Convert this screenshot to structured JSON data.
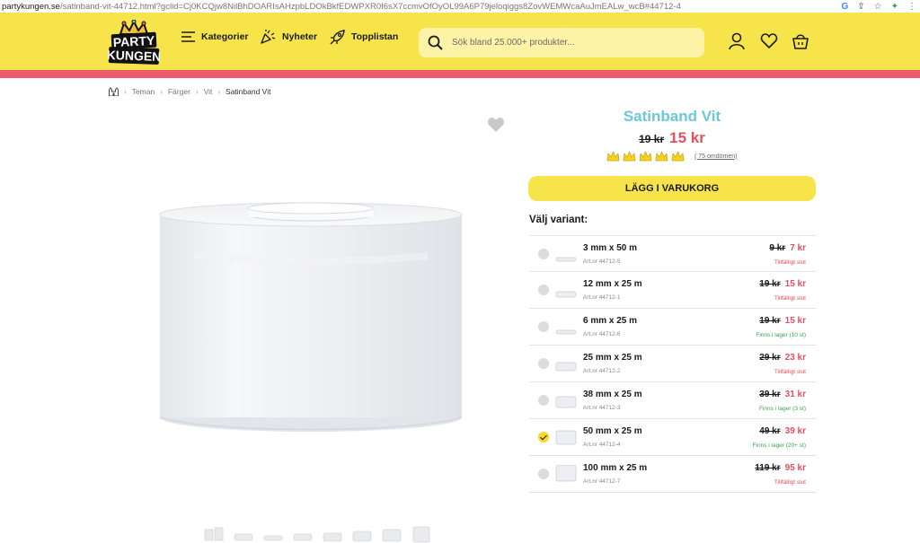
{
  "browser": {
    "url_domain": "partykungen.se",
    "url_rest": "/satinband-vit-44712.html?gclid=Cj0KCQjw8NilBhDOARIsAHzpbLDOkBkfEDWPXR0I6sX7ccmvOfOyOL99A6P79jeloqiggs8ZovWEMWcaAuJmEALw_wcB#44712-4"
  },
  "header": {
    "logo_text": "PARTY KUNGEN",
    "nav": {
      "categories": "Kategorier",
      "news": "Nyheter",
      "toplist": "Topplistan"
    },
    "search_placeholder": "Sök bland 25.000+ produkter...",
    "icons": [
      "search-icon",
      "user-icon",
      "heart-icon",
      "basket-icon"
    ],
    "colors": {
      "primary": "#f7e44a",
      "accent": "#ec5b67"
    }
  },
  "breadcrumb": {
    "items": [
      "Teman",
      "Färger",
      "Vit"
    ],
    "current": "Satinband Vit"
  },
  "product": {
    "title": "Satinband Vit",
    "old_price": "19 kr",
    "new_price": "15 kr",
    "rating": 5,
    "reviews": "( 75 omdömen)",
    "cart_button": "LÄGG I VARUKORG",
    "variant_heading": "Välj variant:",
    "thumbnail_count": 8,
    "colors": {
      "title": "#6cc7d6",
      "price": "#e4505e",
      "in_stock": "#3aa353"
    }
  },
  "variants": [
    {
      "name": "3 mm x 50 m",
      "art": "Art.nr 44712-5",
      "old": "9 kr",
      "new": "7 kr",
      "status": "Tillfälligt slut",
      "in_stock": false,
      "selected": false
    },
    {
      "name": "12 mm x 25 m",
      "art": "Art.nr 44712-1",
      "old": "19 kr",
      "new": "15 kr",
      "status": "Tillfälligt slut",
      "in_stock": false,
      "selected": false
    },
    {
      "name": "6 mm x 25 m",
      "art": "Art.nr 44712-6",
      "old": "19 kr",
      "new": "15 kr",
      "status": "Finns i lager (10 st)",
      "in_stock": true,
      "selected": false
    },
    {
      "name": "25 mm x 25 m",
      "art": "Art.nr 44712-2",
      "old": "29 kr",
      "new": "23 kr",
      "status": "Tillfälligt slut",
      "in_stock": false,
      "selected": false
    },
    {
      "name": "38 mm x 25 m",
      "art": "Art.nr 44712-3",
      "old": "39 kr",
      "new": "31 kr",
      "status": "Finns i lager (3 st)",
      "in_stock": true,
      "selected": false
    },
    {
      "name": "50 mm x 25 m",
      "art": "Art.nr 44712-4",
      "old": "49 kr",
      "new": "39 kr",
      "status": "Finns i lager (20+ st)",
      "in_stock": true,
      "selected": true
    },
    {
      "name": "100 mm x 25 m",
      "art": "Art.nr 44712-7",
      "old": "119 kr",
      "new": "95 kr",
      "status": "Tillfälligt slut",
      "in_stock": false,
      "selected": false
    }
  ]
}
